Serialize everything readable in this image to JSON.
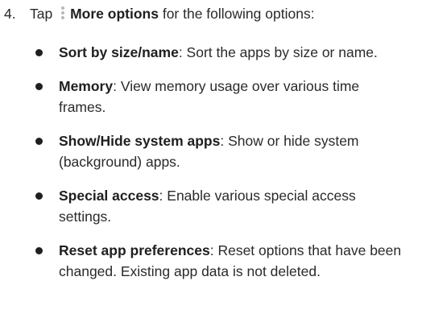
{
  "step": {
    "number": "4.",
    "prefix": "Tap",
    "icon": "more-options-kebab-icon",
    "bold": "More options",
    "suffix": "for the following options:"
  },
  "options": [
    {
      "title": "Sort by size/name",
      "desc": ": Sort the apps by size or name."
    },
    {
      "title": "Memory",
      "desc": ": View memory usage over various time frames."
    },
    {
      "title": "Show/Hide system apps",
      "desc": ": Show or hide system (background) apps."
    },
    {
      "title": "Special access",
      "desc": ": Enable various special access settings."
    },
    {
      "title": "Reset app preferences",
      "desc": ": Reset options that have been changed. Existing app data is not deleted."
    }
  ]
}
